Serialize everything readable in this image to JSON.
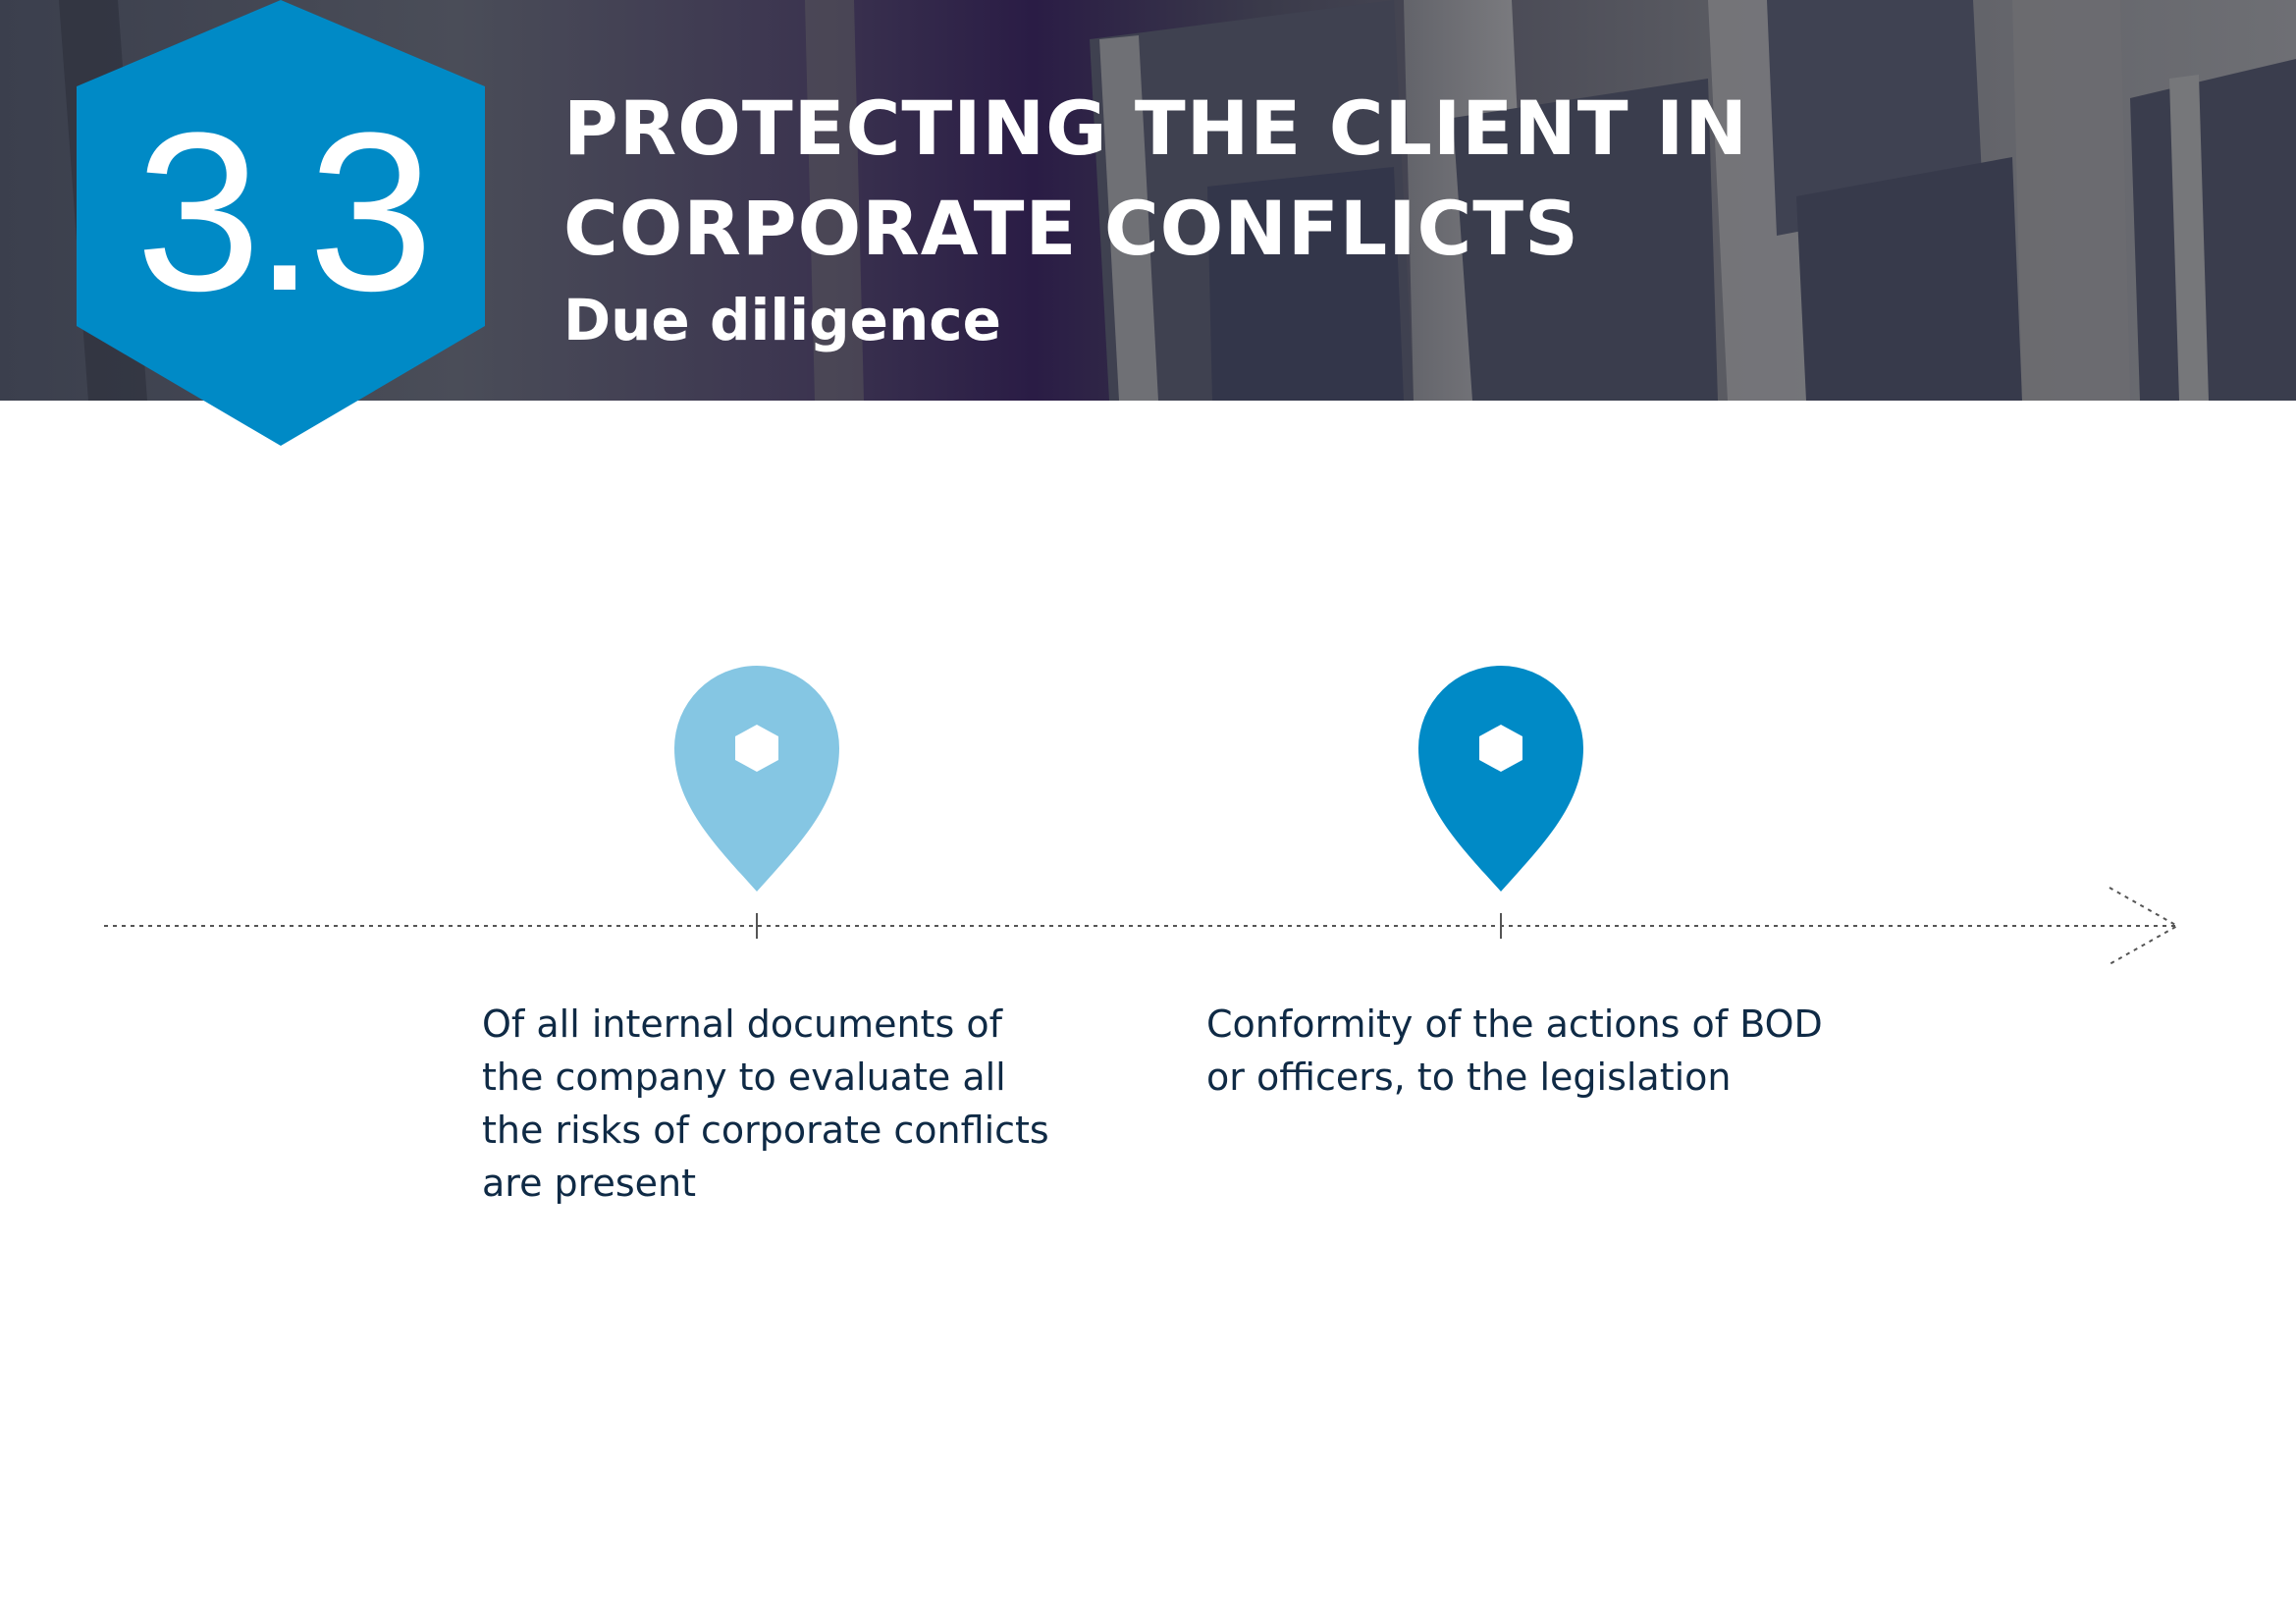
{
  "header": {
    "section_number": "3.3",
    "title": "PROTECTING THE CLIENT IN CORPORATE CONFLICTS",
    "subtitle": "Due diligence"
  },
  "colors": {
    "accent": "#008ac6",
    "accent_light": "#85c6e3",
    "text_dark": "#0f2a45",
    "timeline": "#555555"
  },
  "timeline": {
    "steps": [
      {
        "icon": "map-pin-hexagon-icon",
        "text": "Of all internal documents of the company to evaluate all the risks of corporate conflicts are present"
      },
      {
        "icon": "map-pin-hexagon-icon",
        "text": "Conformity of the actions of BOD or officers, to the legislation"
      }
    ]
  }
}
